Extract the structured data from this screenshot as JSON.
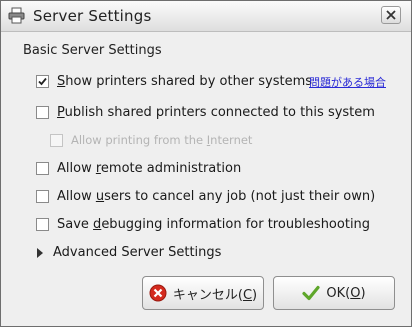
{
  "window": {
    "title": "Server Settings"
  },
  "section_title": "Basic Server Settings",
  "options": [
    {
      "prefix": "",
      "mnemonic": "S",
      "suffix": "how printers shared by other systems",
      "checked": true,
      "enabled": true
    },
    {
      "prefix": "",
      "mnemonic": "P",
      "suffix": "ublish shared printers connected to this system",
      "checked": false,
      "enabled": true
    },
    {
      "prefix": "Allow printing from the ",
      "mnemonic": "I",
      "suffix": "nternet",
      "checked": false,
      "enabled": false
    },
    {
      "prefix": "Allow ",
      "mnemonic": "r",
      "suffix": "emote administration",
      "checked": false,
      "enabled": true
    },
    {
      "prefix": "Allow ",
      "mnemonic": "u",
      "suffix": "sers to cancel any job (not just their own)",
      "checked": false,
      "enabled": true
    },
    {
      "prefix": "Save ",
      "mnemonic": "d",
      "suffix": "ebugging information for troubleshooting",
      "checked": false,
      "enabled": true
    }
  ],
  "problems_link": "問題がある場合",
  "advanced": {
    "label": "Advanced Server Settings",
    "expanded": false
  },
  "buttons": {
    "cancel": {
      "text": "キャンセル(",
      "mnemonic": "C",
      "end": ")"
    },
    "ok": {
      "text": "OK(",
      "mnemonic": "O",
      "end": ")"
    }
  },
  "icons": {
    "title": "printer-icon",
    "cancel": "cancel-icon",
    "ok": "checkmark-icon",
    "close": "close-icon"
  },
  "colors": {
    "link": "#2b2bd6",
    "cancel_icon": "#d42a1e",
    "ok_icon": "#5ea62a"
  }
}
